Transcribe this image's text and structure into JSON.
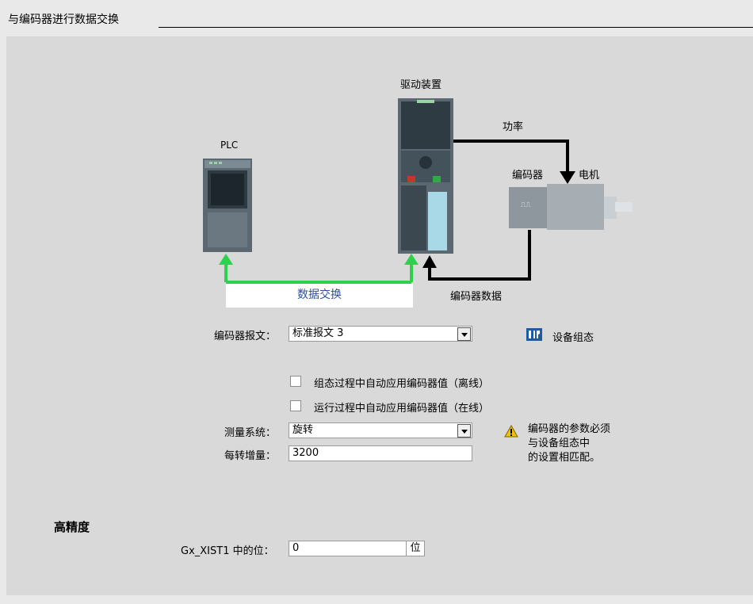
{
  "header": {
    "title": "与编码器进行数据交换"
  },
  "diagram": {
    "plc_label": "PLC",
    "drive_label": "驱动装置",
    "power_label": "功率",
    "encoder_label": "编码器",
    "motor_label": "电机",
    "exchange_label": "数据交换",
    "encoder_data_label": "编码器数据",
    "encoder_symbol": "⎍⎍"
  },
  "form": {
    "telegram_label": "编码器报文：",
    "telegram_value": "标准报文 3",
    "device_config_label": "设备组态",
    "auto_apply_offline_label": "组态过程中自动应用编码器值（离线）",
    "auto_apply_online_label": "运行过程中自动应用编码器值（在线）",
    "measuring_system_label": "测量系统：",
    "measuring_system_value": "旋转",
    "increments_label": "每转增量：",
    "increments_value": "3200",
    "warning_line1": "编码器的参数必须",
    "warning_line2": "与设备组态中",
    "warning_line3": "的设置相匹配。"
  },
  "precision": {
    "title": "高精度",
    "bits_label": "Gx_XIST1 中的位：",
    "bits_value": "0",
    "bits_unit": "位"
  },
  "colors": {
    "arrow_green": "#2ed14e",
    "arrow_black": "#000000",
    "link_blue": "#2c4fa2"
  }
}
